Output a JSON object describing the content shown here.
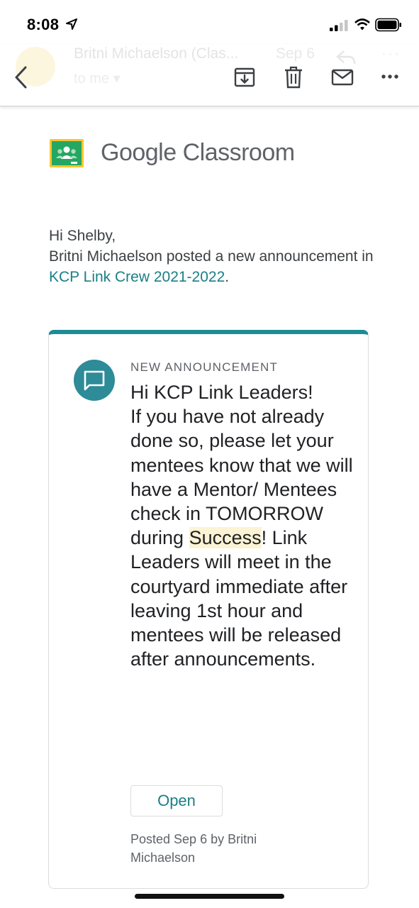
{
  "status_bar": {
    "time": "8:08",
    "icons": [
      "location-arrow-icon",
      "cellular-signal-icon",
      "wifi-icon",
      "battery-icon"
    ]
  },
  "email_header": {
    "sender": "Britni Michaelson (Clas...",
    "date": "Sep 6",
    "recipient": "to me ▾"
  },
  "toolbar": {
    "icons": [
      "back-chevron-icon",
      "archive-icon",
      "trash-icon",
      "mail-icon",
      "more-icon"
    ]
  },
  "email": {
    "brand": "Google Classroom",
    "greeting": "Hi Shelby,",
    "intro_prefix": "Britni Michaelson posted a new announcement in ",
    "class_link": "KCP Link Crew 2021-2022",
    "intro_suffix": ".",
    "card": {
      "label": "NEW ANNOUNCEMENT",
      "body_part1": "Hi KCP Link Leaders!\nIf you have not already done so, please let your mentees know that we will have a Mentor/ Mentees check in TOMORROW during ",
      "highlight": "Success",
      "body_part2": "!  Link Leaders will meet in the courtyard immediate after leaving 1st hour and mentees will be released after announcements.",
      "open_label": "Open",
      "posted": "Posted Sep 6 by Britni Michaelson"
    }
  },
  "colors": {
    "accent": "#1e8c95",
    "link": "#1a7f85",
    "highlight": "#fcf3d4"
  }
}
